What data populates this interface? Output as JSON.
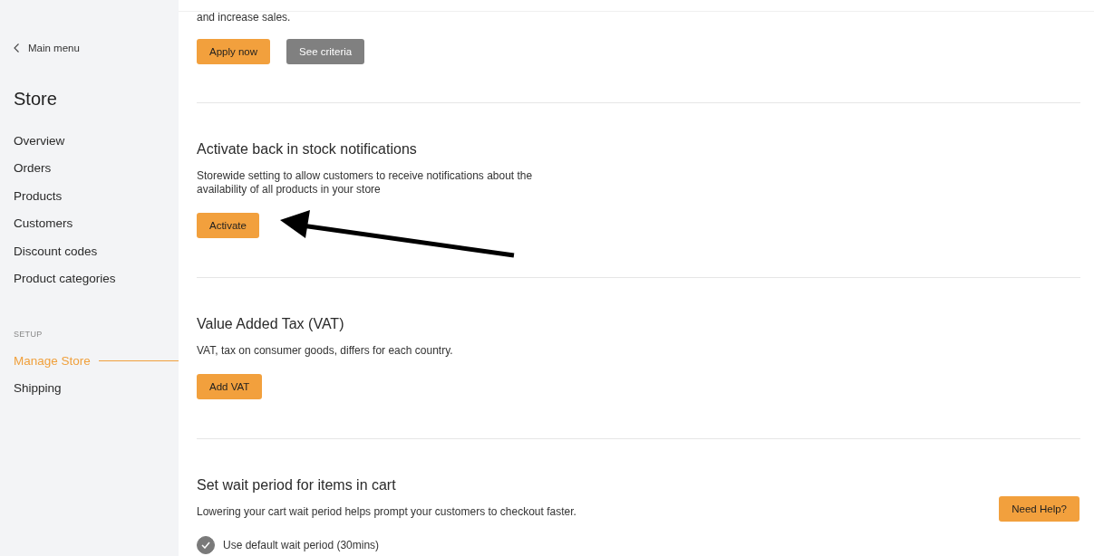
{
  "sidebar": {
    "back_link": "Main menu",
    "title": "Store",
    "items": [
      {
        "label": "Overview",
        "selected": false
      },
      {
        "label": "Orders",
        "selected": false
      },
      {
        "label": "Products",
        "selected": false
      },
      {
        "label": "Customers",
        "selected": false
      },
      {
        "label": "Discount codes",
        "selected": false
      },
      {
        "label": "Product categories",
        "selected": false
      }
    ],
    "groups": [
      {
        "heading": "SETUP",
        "items": [
          {
            "label": "Manage Store",
            "selected": true
          },
          {
            "label": "Shipping",
            "selected": false
          }
        ]
      }
    ]
  },
  "main": {
    "top_section": {
      "description": "and increase sales.",
      "buttons": [
        {
          "label": "Apply now",
          "kind": "primary"
        },
        {
          "label": "See criteria",
          "kind": "secondary"
        }
      ]
    },
    "sections": [
      {
        "title": "Activate back in stock notifications",
        "description": "Storewide setting to allow customers to receive notifications about the availability of all products in your store",
        "buttons": [
          {
            "label": "Activate",
            "kind": "primary"
          }
        ]
      },
      {
        "title": "Value Added Tax (VAT)",
        "description": "VAT, tax on consumer goods, differs for each country.",
        "buttons": [
          {
            "label": "Add VAT",
            "kind": "primary"
          }
        ]
      },
      {
        "title": "Set wait period for items in cart",
        "description": "Lowering your cart wait period helps prompt your customers to checkout faster.",
        "options": [
          {
            "label": "Use default wait period (30mins)",
            "checked": true
          }
        ]
      }
    ]
  },
  "help_button": {
    "label": "Need Help?",
    "kind": "primary"
  }
}
